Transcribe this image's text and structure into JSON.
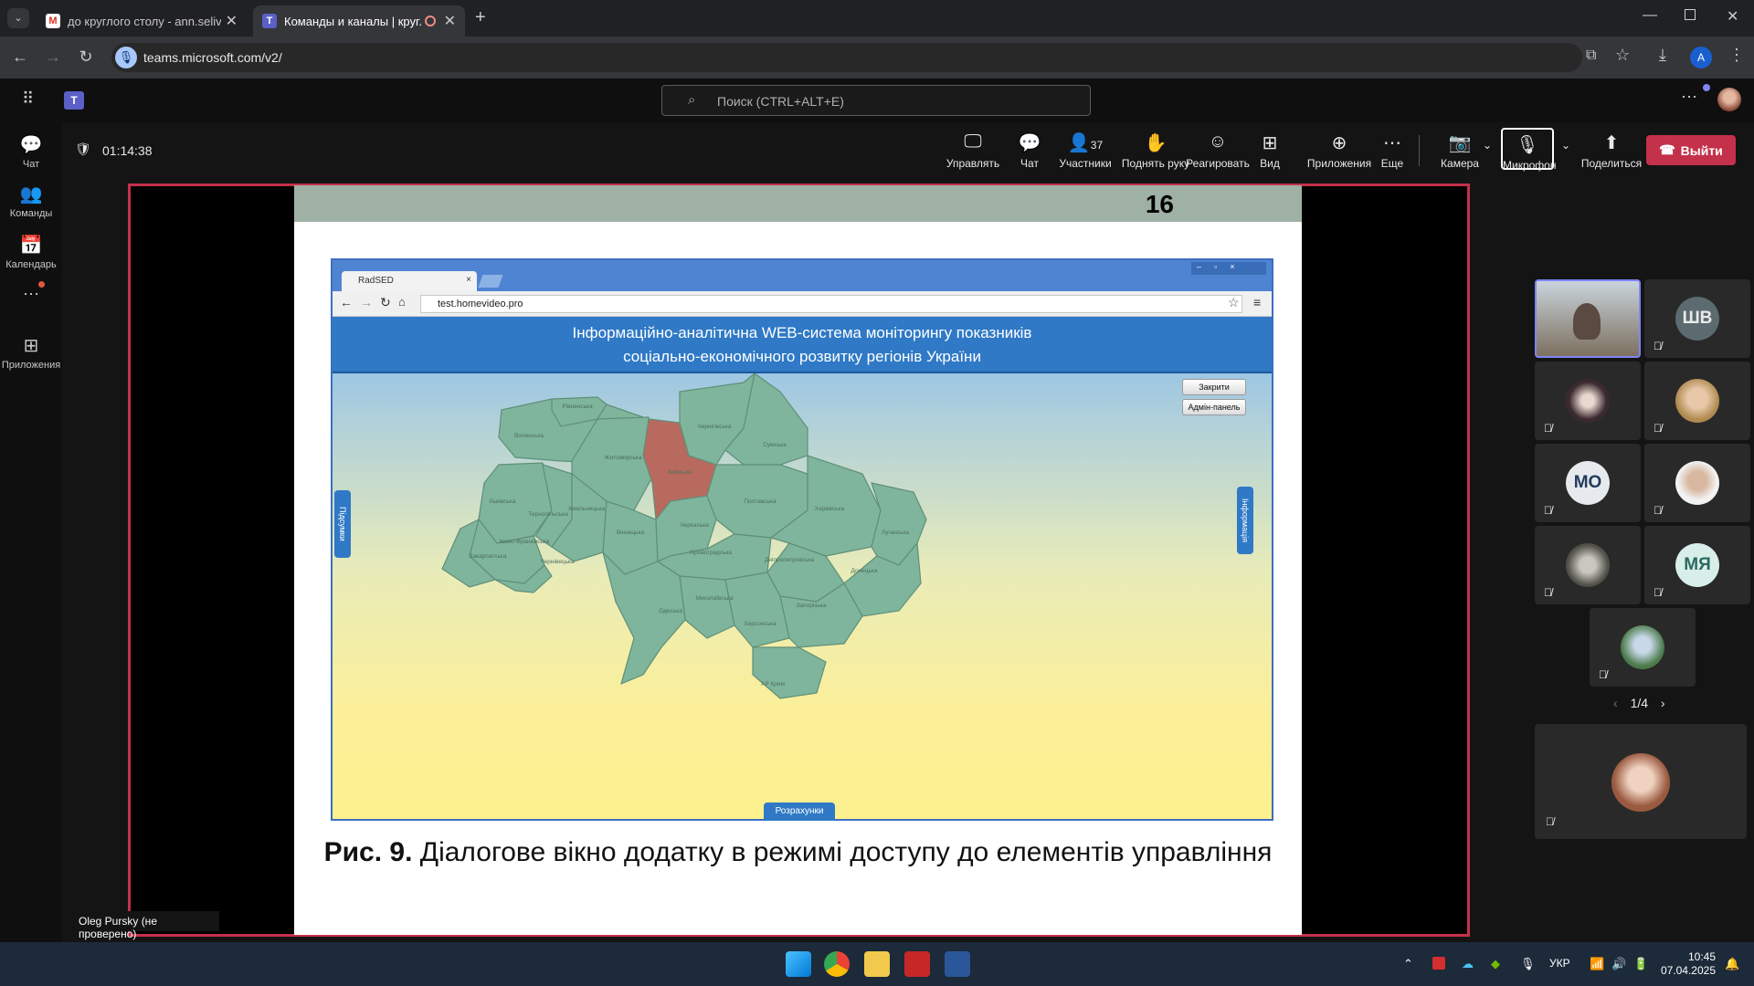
{
  "browser": {
    "tabs": [
      {
        "title": "до круглого столу - ann.selivanova",
        "icon": "gmail-icon"
      },
      {
        "title": "Команды и каналы | круглый стол",
        "icon": "teams-icon"
      }
    ],
    "url": "teams.microsoft.com/v2/",
    "profile_initial": "A"
  },
  "teams": {
    "search_placeholder": "Поиск (CTRL+ALT+E)",
    "rail": [
      {
        "label": "Чат",
        "icon": "chat-icon"
      },
      {
        "label": "Команды",
        "icon": "teams-people-icon"
      },
      {
        "label": "Календарь",
        "icon": "calendar-icon"
      },
      {
        "label": "Приложения",
        "icon": "apps-add-icon"
      }
    ],
    "timer": "01:14:38",
    "toolbar": {
      "control": "Управлять",
      "chat": "Чат",
      "participants": "Участники",
      "participants_count": "37",
      "raise_hand": "Поднять руку",
      "react": "Реагировать",
      "view": "Вид",
      "apps": "Приложения",
      "more": "Еще",
      "camera": "Камера",
      "mic": "Микрофон",
      "share": "Поделиться",
      "leave": "Выйти"
    },
    "presenter_label": "Oleg Pursky (не проверено)",
    "participants": [
      {
        "initials": ""
      },
      {
        "initials": "ШВ"
      },
      {
        "initials": ""
      },
      {
        "initials": ""
      },
      {
        "initials": "МО"
      },
      {
        "initials": ""
      },
      {
        "initials": ""
      },
      {
        "initials": "МЯ"
      },
      {
        "initials": ""
      }
    ],
    "pager": "1/4"
  },
  "slide": {
    "number": "16",
    "inner_browser": {
      "tab_title": "RadSED",
      "url": "test.homevideo.pro",
      "header_line1": "Інформаційно-аналітична WEB-система моніторингу показників",
      "header_line2": "соціально-економічного розвитку регіонів України",
      "btn_close": "Закрити",
      "btn_admin": "Адмін-панель",
      "left_tab": "Підсумки",
      "right_tab": "Інформація",
      "bottom_tab": "Розрахунки",
      "regions": [
        "Волинська",
        "Рівненська",
        "Житомирська",
        "Київська",
        "Чернігівська",
        "Сумська",
        "Львівська",
        "Тернопільська",
        "Хмельницька",
        "Вінницька",
        "Черкаська",
        "Полтавська",
        "Харківська",
        "Луганська",
        "Івано-Франківська",
        "Закарпатська",
        "Чернівецька",
        "Кіровоградська",
        "Дніпропетровська",
        "Донецька",
        "Миколаївська",
        "Одеська",
        "Херсонська",
        "Запорізька",
        "АР Крим"
      ]
    },
    "caption_bold": "Рис. 9.",
    "caption_text": "Діалогове вікно додатку в режимі доступу до елементів управління"
  },
  "taskbar": {
    "lang": "УКР",
    "time": "10:45",
    "date": "07.04.2025"
  },
  "colors": {
    "leave": "#c4314b",
    "share_border": "#c4314b",
    "map_region": "#7fb59c",
    "map_selected": "#b86a5e"
  }
}
